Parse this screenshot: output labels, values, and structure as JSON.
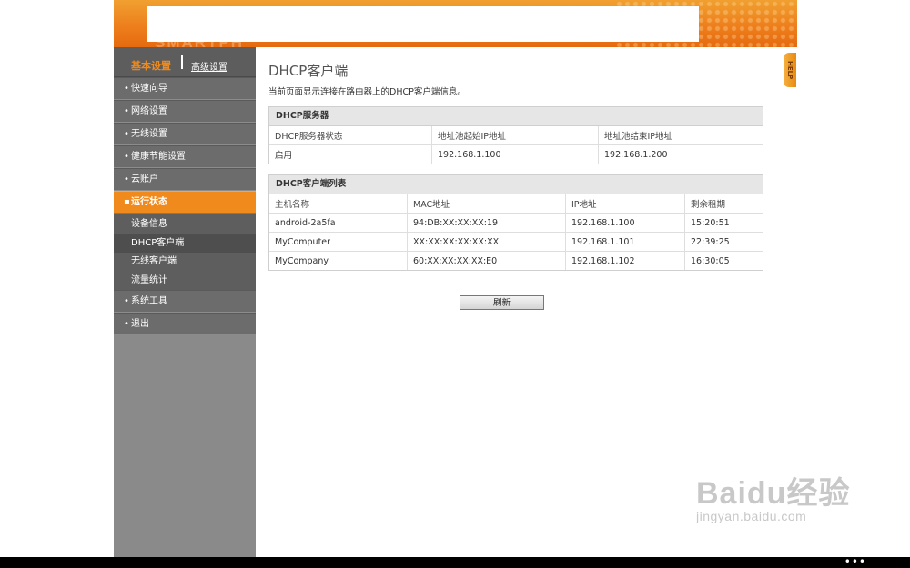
{
  "header": {
    "logo_ghost": "SMARTPH"
  },
  "sidebar": {
    "basic_label": "基本设置",
    "advanced_label": "高级设置",
    "items": [
      {
        "label": "快速向导"
      },
      {
        "label": "网络设置"
      },
      {
        "label": "无线设置"
      },
      {
        "label": "健康节能设置"
      },
      {
        "label": "云账户"
      },
      {
        "label": "运行状态"
      },
      {
        "label": "系统工具"
      },
      {
        "label": "退出"
      }
    ],
    "subitems": [
      {
        "label": "设备信息"
      },
      {
        "label": "DHCP客户端"
      },
      {
        "label": "无线客户端"
      },
      {
        "label": "流量统计"
      }
    ]
  },
  "main": {
    "title": "DHCP客户端",
    "description": "当前页面显示连接在路由器上的DHCP客户端信息。",
    "server_panel": {
      "title": "DHCP服务器",
      "headers": [
        "DHCP服务器状态",
        "地址池起始IP地址",
        "地址池结束IP地址"
      ],
      "values": [
        "启用",
        "192.168.1.100",
        "192.168.1.200"
      ]
    },
    "client_panel": {
      "title": "DHCP客户端列表",
      "headers": [
        "主机名称",
        "MAC地址",
        "IP地址",
        "剩余租期"
      ],
      "rows": [
        {
          "host": "android-2a5fa",
          "mac": "94:DB:XX:XX:XX:19",
          "ip": "192.168.1.100",
          "lease": "15:20:51"
        },
        {
          "host": "MyComputer",
          "mac": "XX:XX:XX:XX:XX:XX",
          "ip": "192.168.1.101",
          "lease": "22:39:25"
        },
        {
          "host": "MyCompany",
          "mac": "60:XX:XX:XX:XX:E0",
          "ip": "192.168.1.102",
          "lease": "16:30:05"
        }
      ]
    },
    "refresh_label": "刷新"
  },
  "help_label": "HELP",
  "watermark": {
    "logo": "Baidu经验",
    "url": "jingyan.baidu.com"
  },
  "bottom_bar": {
    "dots": "•••"
  }
}
